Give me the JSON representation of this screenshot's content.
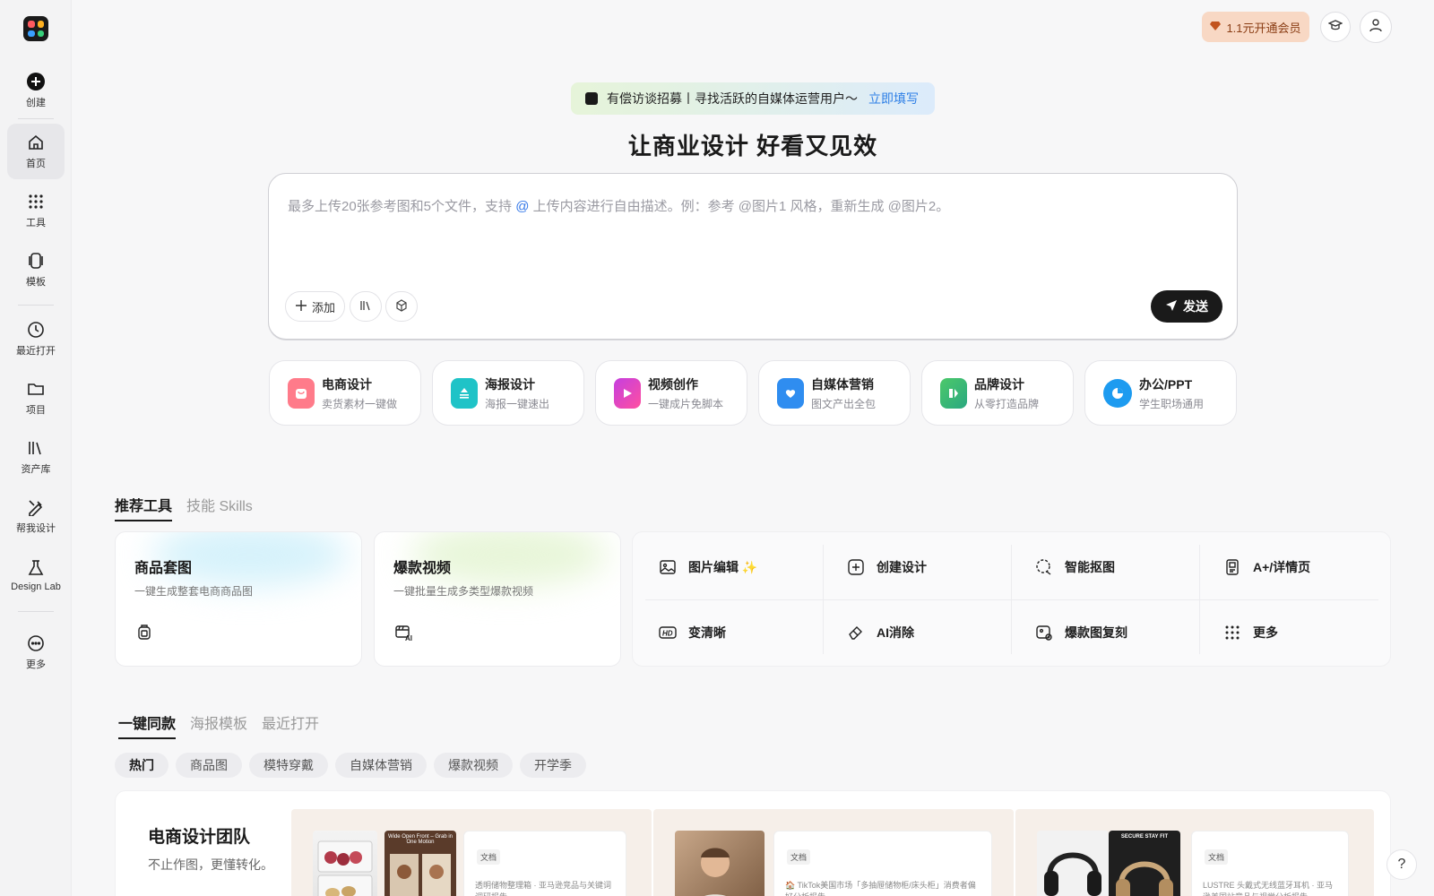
{
  "sidebar": {
    "items": [
      {
        "label": "创建",
        "icon": "plus-circle-icon"
      },
      {
        "label": "首页",
        "icon": "home-icon"
      },
      {
        "label": "工具",
        "icon": "grid-dots-icon"
      },
      {
        "label": "模板",
        "icon": "template-icon"
      },
      {
        "label": "最近打开",
        "icon": "clock-icon"
      },
      {
        "label": "项目",
        "icon": "folder-icon"
      },
      {
        "label": "资产库",
        "icon": "library-icon"
      },
      {
        "label": "帮我设计",
        "icon": "design-tools-icon"
      },
      {
        "label": "Design Lab",
        "icon": "lab-flask-icon"
      },
      {
        "label": "更多",
        "icon": "more-dots-icon"
      }
    ]
  },
  "header": {
    "vip_label": "1.1元开通会员",
    "vip_icon": "diamond-icon"
  },
  "banner": {
    "text": "有偿访谈招募丨寻找活跃的自媒体运营用户～",
    "link": "立即填写"
  },
  "hero": {
    "title": "让商业设计 好看又见效"
  },
  "prompt": {
    "placeholder_before": "最多上传20张参考图和5个文件，支持",
    "placeholder_at": "@",
    "placeholder_after": "上传内容进行自由描述。例：参考 @图片1 风格，重新生成 @图片2。",
    "add_label": "添加",
    "send_label": "发送"
  },
  "categories": [
    {
      "title": "电商设计",
      "subtitle": "卖货素材一键做",
      "color": "#f06a7a"
    },
    {
      "title": "海报设计",
      "subtitle": "海报一键速出",
      "color": "#1fc3c7"
    },
    {
      "title": "视频创作",
      "subtitle": "一键成片免脚本",
      "color": "#d64fd8"
    },
    {
      "title": "自媒体营销",
      "subtitle": "图文产出全包",
      "color": "#2f8df0"
    },
    {
      "title": "品牌设计",
      "subtitle": "从零打造品牌",
      "color": "#3cc06a"
    },
    {
      "title": "办公/PPT",
      "subtitle": "学生职场通用",
      "color": "#1d9bf0"
    }
  ],
  "tool_tabs": [
    "推荐工具",
    "技能 Skills"
  ],
  "big_tools": [
    {
      "title": "商品套图",
      "subtitle": "一键生成整套电商商品图"
    },
    {
      "title": "爆款视频",
      "subtitle": "一键批量生成多类型爆款视频"
    }
  ],
  "tools": [
    {
      "label": "图片编辑 ✨",
      "icon": "image-edit-icon"
    },
    {
      "label": "创建设计",
      "icon": "plus-square-icon"
    },
    {
      "label": "智能抠图",
      "icon": "cutout-icon"
    },
    {
      "label": "A+/详情页",
      "icon": "detail-page-icon"
    },
    {
      "label": "变清晰",
      "icon": "hd-icon"
    },
    {
      "label": "AI消除",
      "icon": "eraser-icon"
    },
    {
      "label": "爆款图复刻",
      "icon": "image-copy-icon"
    },
    {
      "label": "更多",
      "icon": "grid-more-icon"
    }
  ],
  "template_tabs": [
    "一键同款",
    "海报模板",
    "最近打开"
  ],
  "filters": [
    "热门",
    "商品图",
    "模特穿戴",
    "自媒体营销",
    "爆款视频",
    "开学季"
  ],
  "team": {
    "title": "电商设计团队",
    "subtitle": "不止作图，更懂转化。"
  },
  "previews": [
    {
      "tag": "文档",
      "text": "透明储物整理箱 · 亚马逊竞品与关键词调研报告",
      "thumb_text": "Wide Open Front – Grab in One Motion"
    },
    {
      "tag": "文档",
      "text": "🏠 TikTok美国市场「多抽屉储物柜/床头柜」消费者偏好分析报告",
      "thumb_text": ""
    },
    {
      "tag": "文档",
      "text": "LUSTRE 头戴式无线蓝牙耳机 · 亚马逊美国站竞品与视觉分析报告",
      "thumb_text": "SECURE STAY FIT"
    }
  ],
  "help_label": "?"
}
